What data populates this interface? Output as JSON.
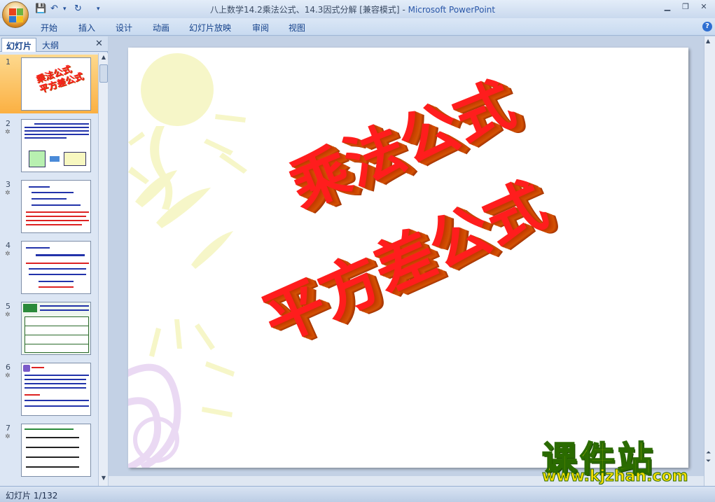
{
  "window": {
    "doc_title": "八上数学14.2乘法公式、14.3因式分解 [兼容模式]",
    "app_name": "Microsoft PowerPoint",
    "separator": " - "
  },
  "quick_access": {
    "save_icon": "save-icon",
    "undo_icon": "undo-icon",
    "redo_icon": "redo-icon"
  },
  "ribbon": {
    "tabs": [
      "开始",
      "插入",
      "设计",
      "动画",
      "幻灯片放映",
      "审阅",
      "视图"
    ]
  },
  "pane": {
    "tabs": [
      "幻灯片",
      "大纲"
    ],
    "close": "✕"
  },
  "thumbnails": [
    {
      "num": "1",
      "line1": "乘法公式",
      "line2": "平方差公式",
      "selected": true
    },
    {
      "num": "2",
      "star": "✲"
    },
    {
      "num": "3",
      "star": "✲"
    },
    {
      "num": "4",
      "star": "✲"
    },
    {
      "num": "5",
      "star": "✲"
    },
    {
      "num": "6",
      "star": "✲"
    },
    {
      "num": "7",
      "star": "✲"
    }
  ],
  "slide": {
    "line1": "乘法公式",
    "line2": "平方差公式"
  },
  "status": {
    "text": "幻灯片 1/132"
  },
  "watermark": {
    "main": "课件站",
    "url": "www.kjzhan.com"
  },
  "colors": {
    "accent": "#ff1d1d",
    "extrude": "#c84200",
    "ribbon": "#15428b"
  }
}
